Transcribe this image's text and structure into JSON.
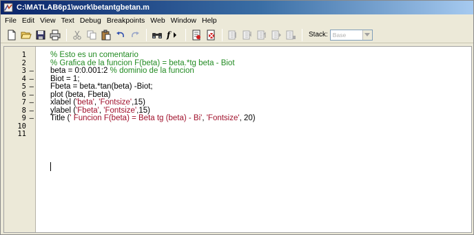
{
  "window": {
    "title": "C:\\MATLAB6p1\\work\\betantgbetan.m"
  },
  "menu": {
    "items": [
      "File",
      "Edit",
      "View",
      "Text",
      "Debug",
      "Breakpoints",
      "Web",
      "Window",
      "Help"
    ]
  },
  "toolbar": {
    "buttons": [
      "new-file-icon",
      "open-folder-icon",
      "save-icon",
      "print-icon",
      "cut-icon",
      "copy-icon",
      "paste-icon",
      "undo-icon",
      "redo-icon",
      "find-icon",
      "function-icon",
      "set-breakpoint-icon",
      "clear-breakpoint-icon",
      "step-icon",
      "step-in-icon",
      "step-out-icon",
      "continue-icon",
      "exit-debug-icon"
    ],
    "stack_label": "Stack:",
    "stack_value": "Base"
  },
  "editor": {
    "lines": [
      {
        "num": "1",
        "mark": "",
        "parts": [
          {
            "t": "% Esto es un comentario",
            "k": "comment"
          }
        ]
      },
      {
        "num": "2",
        "mark": "",
        "parts": [
          {
            "t": "% Grafica de la funcion F(beta) = beta.*tg beta - Biot",
            "k": "comment"
          }
        ]
      },
      {
        "num": "3",
        "mark": "–",
        "parts": [
          {
            "t": "beta = 0:0.001:2 ",
            "k": "code"
          },
          {
            "t": "% dominio de la funcion",
            "k": "comment"
          }
        ]
      },
      {
        "num": "4",
        "mark": "–",
        "parts": [
          {
            "t": "Biot = 1;",
            "k": "code"
          }
        ]
      },
      {
        "num": "5",
        "mark": "–",
        "parts": [
          {
            "t": "Fbeta = beta.*tan(beta) -Biot;",
            "k": "code"
          }
        ]
      },
      {
        "num": "6",
        "mark": "–",
        "parts": [
          {
            "t": "plot (beta, Fbeta)",
            "k": "code"
          }
        ]
      },
      {
        "num": "7",
        "mark": "–",
        "parts": [
          {
            "t": "xlabel (",
            "k": "code"
          },
          {
            "t": "'beta'",
            "k": "string"
          },
          {
            "t": ", ",
            "k": "code"
          },
          {
            "t": "'Fontsize'",
            "k": "string"
          },
          {
            "t": ",15)",
            "k": "code"
          }
        ]
      },
      {
        "num": "8",
        "mark": "–",
        "parts": [
          {
            "t": "ylabel (",
            "k": "code"
          },
          {
            "t": "'Fbeta'",
            "k": "string"
          },
          {
            "t": ", ",
            "k": "code"
          },
          {
            "t": "'Fontsize'",
            "k": "string"
          },
          {
            "t": ",15)",
            "k": "code"
          }
        ]
      },
      {
        "num": "9",
        "mark": "–",
        "parts": [
          {
            "t": "Title (",
            "k": "code"
          },
          {
            "t": "' Funcion F(beta) = Beta tg (beta) - Bi'",
            "k": "string"
          },
          {
            "t": ", ",
            "k": "code"
          },
          {
            "t": "'Fontsize'",
            "k": "string"
          },
          {
            "t": ", 20)",
            "k": "code"
          }
        ]
      },
      {
        "num": "10",
        "mark": "",
        "parts": []
      },
      {
        "num": "11",
        "mark": "",
        "parts": []
      }
    ]
  }
}
